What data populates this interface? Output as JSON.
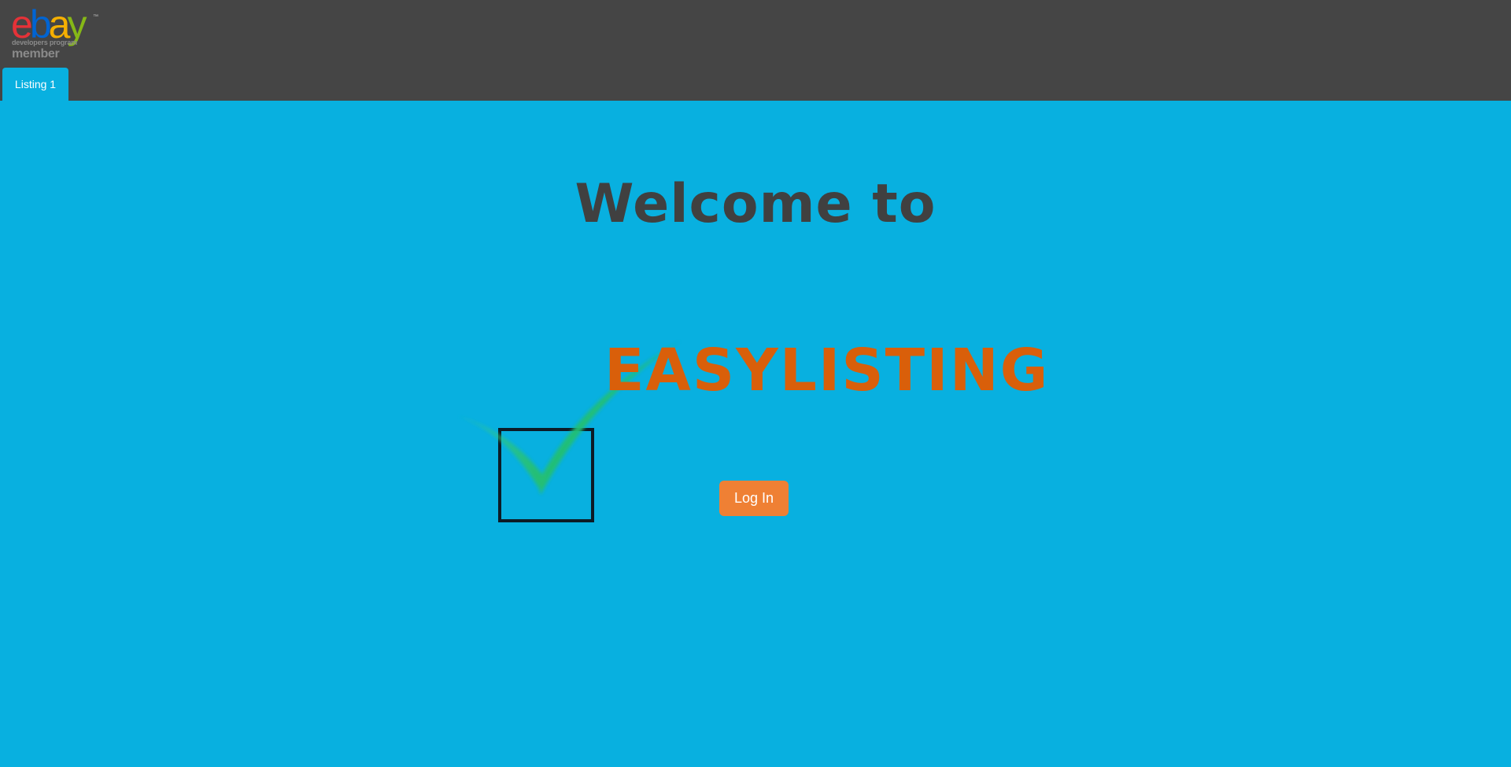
{
  "header": {
    "logo": {
      "letters": [
        "e",
        "b",
        "a",
        "y"
      ],
      "letter_colors": [
        "#e53238",
        "#0064d2",
        "#f5af02",
        "#86b817"
      ],
      "tm": "™",
      "subtitle": "developers program",
      "member_label": "member"
    },
    "tabs": [
      {
        "label": "Listing 1",
        "active": true
      }
    ]
  },
  "main": {
    "welcome_text": "Welcome to",
    "brand_name": "EASYLISTING",
    "brand_icon": "checkbox-checkmark-icon",
    "login_label": "Log In"
  },
  "colors": {
    "header_bg": "#454545",
    "page_bg": "#08b0e0",
    "brand_text": "#d95f0a",
    "welcome_text": "#404040",
    "login_button": "#ef8034",
    "checkmark": "#22c07a"
  }
}
